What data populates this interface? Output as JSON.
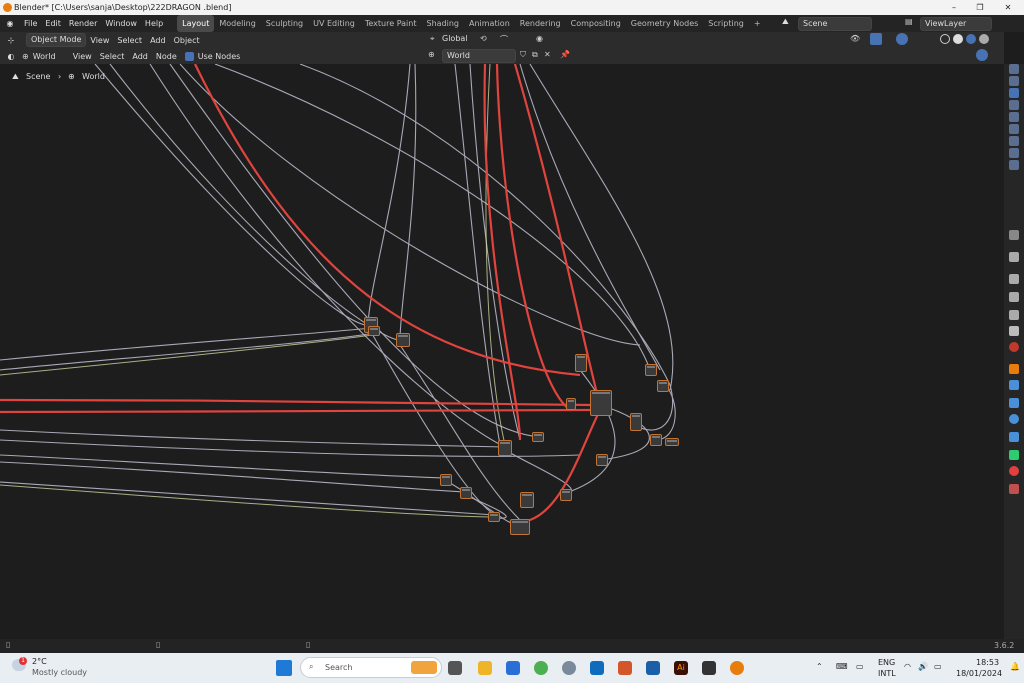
{
  "window": {
    "title": "Blender* [C:\\Users\\sanja\\Desktop\\222DRAGON .blend]",
    "minimize": "–",
    "maximize": "❐",
    "close": "✕"
  },
  "menu": {
    "items": [
      "File",
      "Edit",
      "Render",
      "Window",
      "Help"
    ]
  },
  "workspaces": {
    "tabs": [
      "Layout",
      "Modeling",
      "Sculpting",
      "UV Editing",
      "Texture Paint",
      "Shading",
      "Animation",
      "Rendering",
      "Compositing",
      "Geometry Nodes",
      "Scripting"
    ],
    "add": "+"
  },
  "scene": {
    "label": "Scene",
    "viewlayer": "ViewLayer"
  },
  "header1": {
    "mode": "Object Mode",
    "view": "View",
    "select": "Select",
    "add": "Add",
    "object": "Object",
    "orientation": "Global"
  },
  "header2": {
    "type": "World",
    "view": "View",
    "select": "Select",
    "add": "Add",
    "node": "Node",
    "use_nodes": "Use Nodes",
    "datablock": "World"
  },
  "breadcrumb": {
    "scene": "Scene",
    "world": "World"
  },
  "status": {
    "version": "3.6.2"
  },
  "taskbar": {
    "weather_temp": "2°C",
    "weather_desc": "Mostly cloudy",
    "search_placeholder": "Search",
    "lang1": "ENG",
    "lang2": "INTL",
    "time": "18:53",
    "date": "18/01/2024",
    "notif_badge": "1"
  },
  "colors": {
    "accent": "#e87d0d",
    "link_red": "#e0443e",
    "link_gray": "#b8b8c8",
    "node_border": "#c37434"
  }
}
